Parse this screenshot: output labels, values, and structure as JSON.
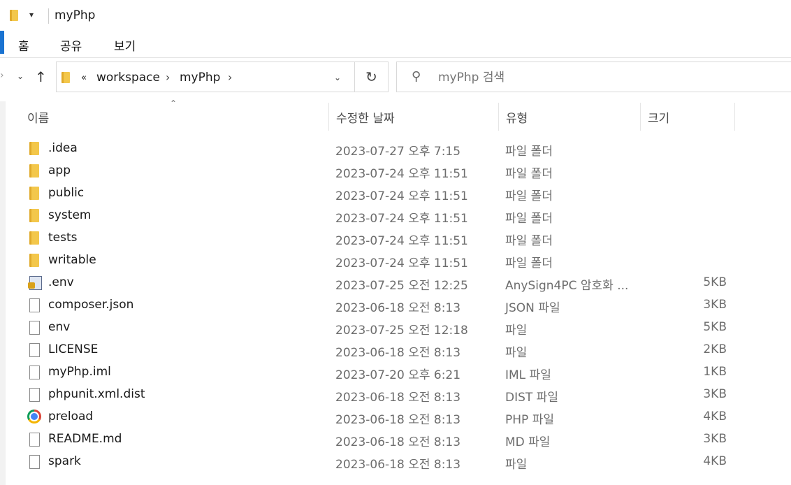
{
  "window": {
    "title": "myPhp",
    "quick_access_arrow": "▾"
  },
  "ribbon": {
    "tabs": [
      "홈",
      "공유",
      "보기"
    ]
  },
  "nav": {
    "back": "›",
    "recent": "⌄",
    "up": "↑"
  },
  "address": {
    "prefix": "«",
    "crumbs": [
      "workspace",
      "myPhp"
    ],
    "sep": "›",
    "dropdown": "⌄",
    "refresh": "↻"
  },
  "search": {
    "placeholder": "myPhp 검색",
    "icon": "search-icon"
  },
  "columns": {
    "name": "이름",
    "date": "수정한 날짜",
    "type": "유형",
    "size": "크기",
    "sort": "⌃"
  },
  "files": [
    {
      "name": ".idea",
      "date": "2023-07-27 오후 7:15",
      "type": "파일 폴더",
      "size": "",
      "icon": "folder-icon"
    },
    {
      "name": "app",
      "date": "2023-07-24 오후 11:51",
      "type": "파일 폴더",
      "size": "",
      "icon": "folder-icon"
    },
    {
      "name": "public",
      "date": "2023-07-24 오후 11:51",
      "type": "파일 폴더",
      "size": "",
      "icon": "folder-icon"
    },
    {
      "name": "system",
      "date": "2023-07-24 오후 11:51",
      "type": "파일 폴더",
      "size": "",
      "icon": "folder-icon"
    },
    {
      "name": "tests",
      "date": "2023-07-24 오후 11:51",
      "type": "파일 폴더",
      "size": "",
      "icon": "folder-icon"
    },
    {
      "name": "writable",
      "date": "2023-07-24 오후 11:51",
      "type": "파일 폴더",
      "size": "",
      "icon": "folder-icon"
    },
    {
      "name": ".env",
      "date": "2023-07-25 오전 12:25",
      "type": "AnySign4PC 암호화 ...",
      "size": "5KB",
      "icon": "encrypted-file-icon"
    },
    {
      "name": "composer.json",
      "date": "2023-06-18 오전 8:13",
      "type": "JSON 파일",
      "size": "3KB",
      "icon": "file-icon"
    },
    {
      "name": "env",
      "date": "2023-07-25 오전 12:18",
      "type": "파일",
      "size": "5KB",
      "icon": "file-icon"
    },
    {
      "name": "LICENSE",
      "date": "2023-06-18 오전 8:13",
      "type": "파일",
      "size": "2KB",
      "icon": "file-icon"
    },
    {
      "name": "myPhp.iml",
      "date": "2023-07-20 오후 6:21",
      "type": "IML 파일",
      "size": "1KB",
      "icon": "file-icon"
    },
    {
      "name": "phpunit.xml.dist",
      "date": "2023-06-18 오전 8:13",
      "type": "DIST 파일",
      "size": "3KB",
      "icon": "file-icon"
    },
    {
      "name": "preload",
      "date": "2023-06-18 오전 8:13",
      "type": "PHP 파일",
      "size": "4KB",
      "icon": "chrome-icon"
    },
    {
      "name": "README.md",
      "date": "2023-06-18 오전 8:13",
      "type": "MD 파일",
      "size": "3KB",
      "icon": "file-icon"
    },
    {
      "name": "spark",
      "date": "2023-06-18 오전 8:13",
      "type": "파일",
      "size": "4KB",
      "icon": "file-icon"
    }
  ],
  "colors": {
    "accent": "#1a73d1",
    "folder": "#f3c74b"
  }
}
